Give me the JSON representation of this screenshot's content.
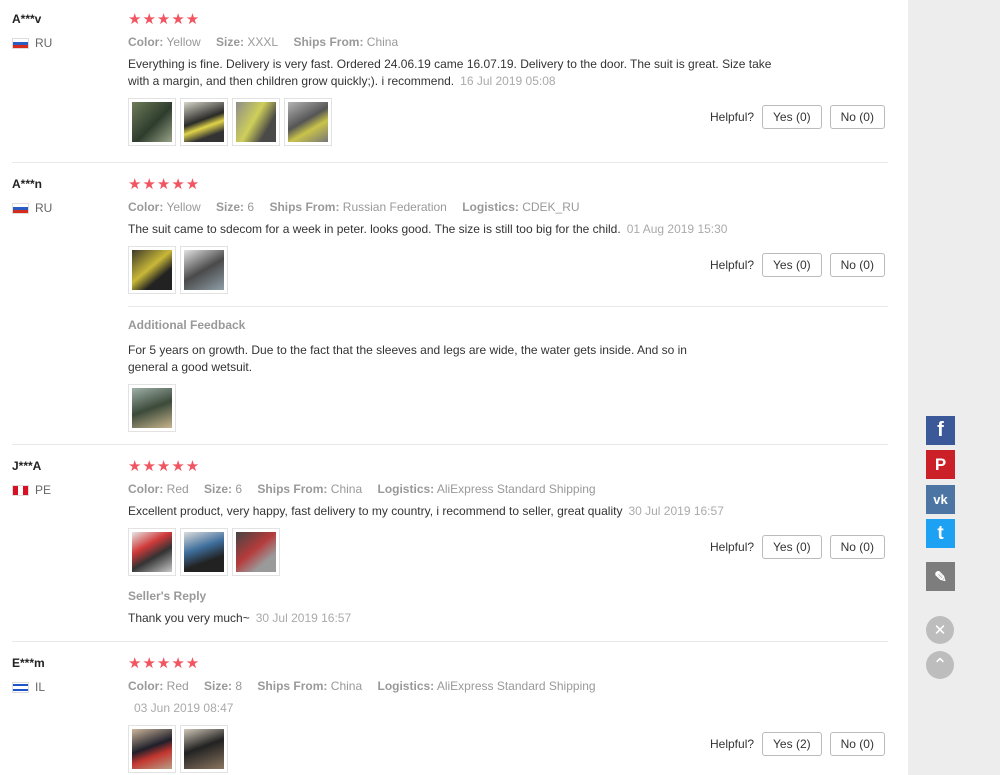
{
  "colors": {
    "star": "#f05561",
    "facebook": "#3b5998",
    "pinterest": "#cb2027",
    "vk": "#4c75a3",
    "twitter": "#1da1f2",
    "pencil": "#7d7d7d"
  },
  "helpful_label": "Helpful?",
  "reviews": [
    {
      "user": "A***v",
      "country": "RU",
      "stars": "★★★★★",
      "meta": [
        {
          "k": "Color:",
          "v": "Yellow"
        },
        {
          "k": "Size:",
          "v": "XXXL"
        },
        {
          "k": "Ships From:",
          "v": "China"
        }
      ],
      "text": "Everything is fine. Delivery is very fast. Ordered 24.06.19 came 16.07.19. Delivery to the door. The suit is great. Size take with a margin, and then children grow quickly;). i recommend.",
      "date": "16 Jul 2019 05:08",
      "yes": "Yes (0)",
      "no": "No (0)"
    },
    {
      "user": "A***n",
      "country": "RU",
      "stars": "★★★★★",
      "meta": [
        {
          "k": "Color:",
          "v": "Yellow"
        },
        {
          "k": "Size:",
          "v": "6"
        },
        {
          "k": "Ships From:",
          "v": "Russian Federation"
        },
        {
          "k": "Logistics:",
          "v": "CDEK_RU"
        }
      ],
      "text": "The suit came to sdecom for a week in peter. looks good. The size is still too big for the child.",
      "date": "01 Aug 2019 15:30",
      "yes": "Yes (0)",
      "no": "No (0)",
      "additional_title": "Additional Feedback",
      "additional_text": "For 5 years on growth. Due to the fact that the sleeves and legs are wide, the water gets inside. And so in general a good wetsuit."
    },
    {
      "user": "J***A",
      "country": "PE",
      "stars": "★★★★★",
      "meta": [
        {
          "k": "Color:",
          "v": "Red"
        },
        {
          "k": "Size:",
          "v": "6"
        },
        {
          "k": "Ships From:",
          "v": "China"
        },
        {
          "k": "Logistics:",
          "v": "AliExpress Standard Shipping"
        }
      ],
      "text": "Excellent product, very happy, fast delivery to my country, i recommend to seller, great quality",
      "date": "30 Jul 2019 16:57",
      "yes": "Yes (0)",
      "no": "No (0)",
      "reply_title": "Seller's Reply",
      "reply_text": "Thank you very much~",
      "reply_date": "30 Jul 2019 16:57"
    },
    {
      "user": "E***m",
      "country": "IL",
      "stars": "★★★★★",
      "meta": [
        {
          "k": "Color:",
          "v": "Red"
        },
        {
          "k": "Size:",
          "v": "8"
        },
        {
          "k": "Ships From:",
          "v": "China"
        },
        {
          "k": "Logistics:",
          "v": "AliExpress Standard Shipping"
        }
      ],
      "date": "03 Jun 2019 08:47",
      "yes": "Yes (2)",
      "no": "No (0)"
    }
  ],
  "share": {
    "facebook": "f",
    "pinterest": "P",
    "vk": "vk",
    "twitter": "t",
    "edit": "✎",
    "close": "✕",
    "top": "⌃"
  }
}
